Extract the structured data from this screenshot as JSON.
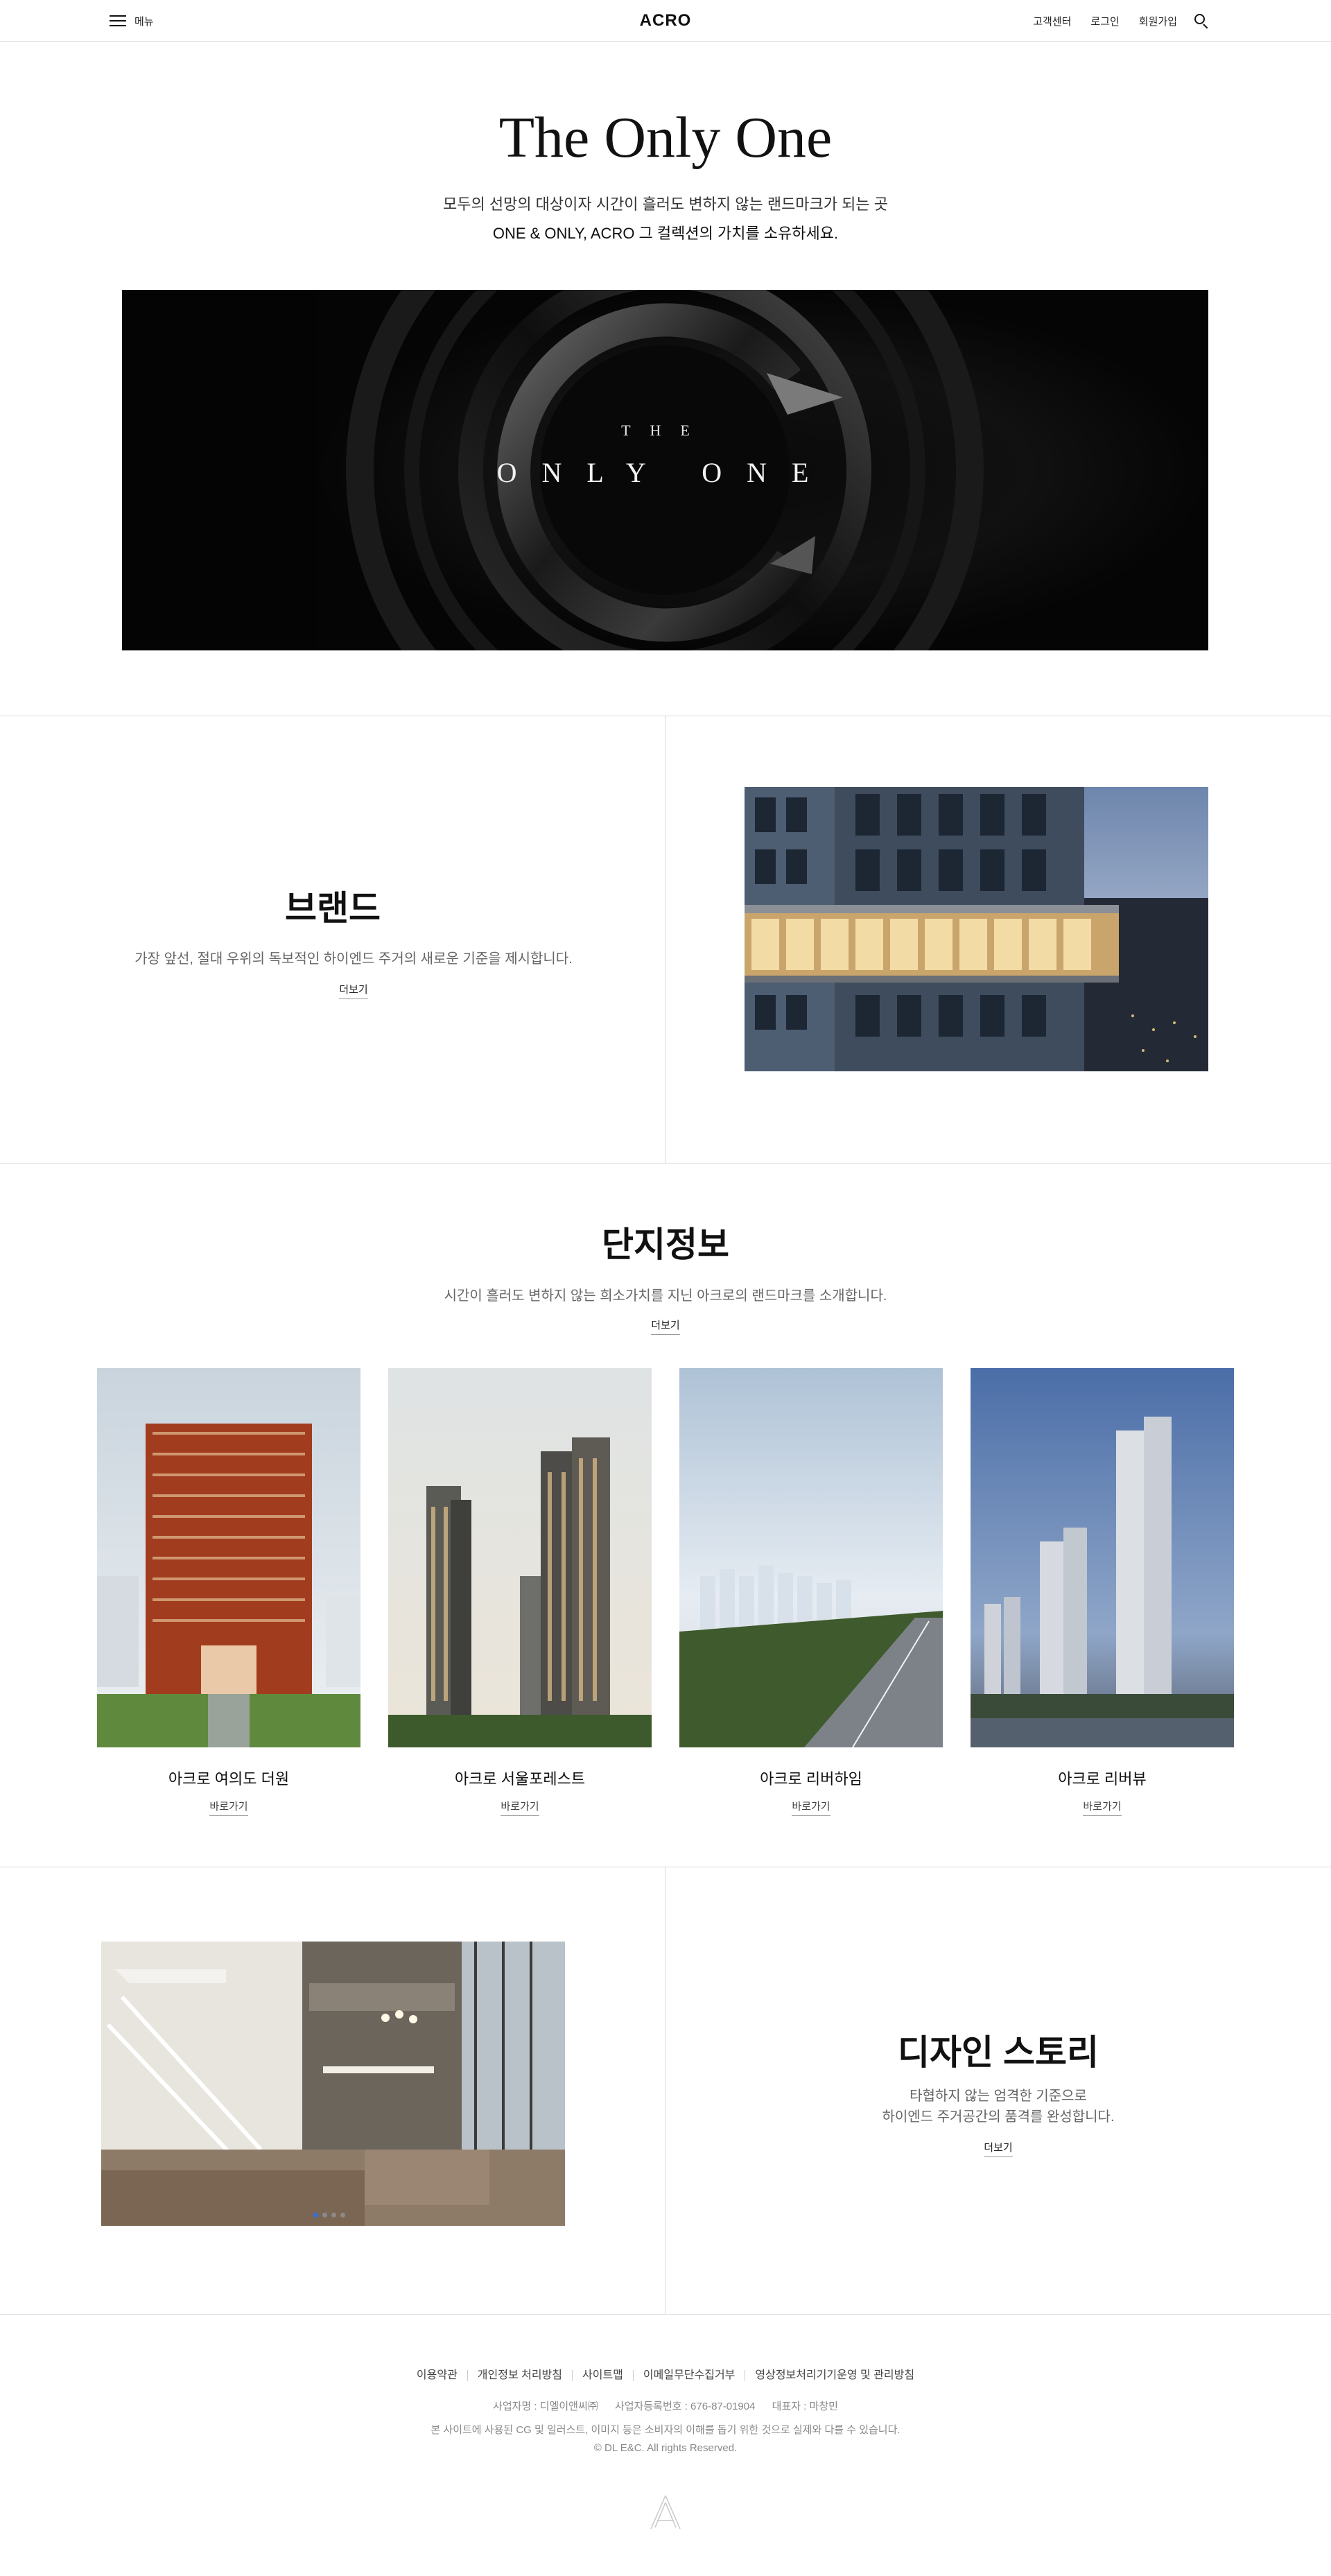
{
  "header": {
    "menu_label": "메뉴",
    "logo": "ACRO",
    "links": [
      "고객센터",
      "로그인",
      "회원가입"
    ],
    "search_icon": "search-icon"
  },
  "hero": {
    "title": "The Only One",
    "desc_line1": "모두의 선망의 대상이자 시간이 흘러도 변하지 않는 랜드마크가 되는 곳",
    "desc_line2": "ONE & ONLY, ACRO 그 컬렉션의 가치를 소유하세요.",
    "banner_the": "THE",
    "banner_only_one": "ONLY ONE"
  },
  "brand": {
    "title": "브랜드",
    "desc": "가장 앞선, 절대 우위의 독보적인 하이엔드 주거의 새로운 기준을 제시합니다.",
    "more": "더보기"
  },
  "complex": {
    "title": "단지정보",
    "desc": "시간이 흘러도 변하지 않는 희소가치를 지닌 아크로의 랜드마크를 소개합니다.",
    "more": "더보기",
    "cards": [
      {
        "name": "아크로 여의도 더원",
        "link": "바로가기"
      },
      {
        "name": "아크로 서울포레스트",
        "link": "바로가기"
      },
      {
        "name": "아크로 리버하임",
        "link": "바로가기"
      },
      {
        "name": "아크로 리버뷰",
        "link": "바로가기"
      }
    ]
  },
  "design_story": {
    "title": "디자인 스토리",
    "desc_line1": "타협하지 않는 엄격한 기준으로",
    "desc_line2": "하이엔드 주거공간의 품격를 완성합니다.",
    "more": "더보기"
  },
  "footer": {
    "links": [
      "이용약관",
      "개인정보 처리방침",
      "사이트맵",
      "이메일무단수집거부",
      "영상정보처리기기운영 및 관리방침"
    ],
    "company": "사업자명 : 디엘이앤씨㈜",
    "biz_no": "사업자등록번호 : 676-87-01904",
    "ceo": "대표자 : 마창민",
    "note": "본 사이트에 사용된 CG 및 일러스트, 이미지 등은 소비자의 이해를 돕기 위한 것으로 실제와 다를 수 있습니다.",
    "copyright": "© DL E&C. All rights Reserved."
  },
  "colors": {
    "text": "#111111",
    "muted": "#666666",
    "line": "#d9d9d9",
    "slider_dot_active": "#3a6fd8"
  }
}
